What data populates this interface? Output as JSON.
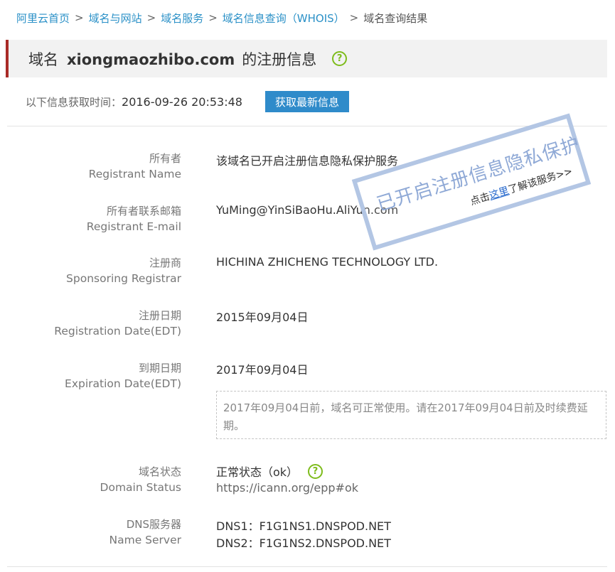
{
  "breadcrumb": {
    "items": [
      {
        "label": "阿里云首页"
      },
      {
        "label": "域名与网站"
      },
      {
        "label": "域名服务"
      },
      {
        "label": "域名信息查询（WHOIS）"
      }
    ],
    "separator": ">",
    "current": "域名查询结果"
  },
  "title": {
    "prefix": "域名",
    "domain": "xiongmaozhibo.com",
    "suffix": "的注册信息",
    "help_icon": "question-circle-icon",
    "help_glyph": "?"
  },
  "fetch": {
    "label": "以下信息获取时间：",
    "time": "2016-09-26 20:53:48",
    "button_label": "获取最新信息"
  },
  "fields": {
    "owner": {
      "label_cn": "所有者",
      "label_en": "Registrant Name",
      "value": "该域名已开启注册信息隐私保护服务"
    },
    "email": {
      "label_cn": "所有者联系邮箱",
      "label_en": "Registrant E-mail",
      "value": "YuMing@YinSiBaoHu.AliYun.com"
    },
    "registrar": {
      "label_cn": "注册商",
      "label_en": "Sponsoring Registrar",
      "value": "HICHINA ZHICHENG TECHNOLOGY LTD."
    },
    "reg_date": {
      "label_cn": "注册日期",
      "label_en": "Registration Date(EDT)",
      "value": "2015年09月04日"
    },
    "exp_date": {
      "label_cn": "到期日期",
      "label_en": "Expiration Date(EDT)",
      "value": "2017年09月04日",
      "note": "2017年09月04日前，域名可正常使用。请在2017年09月04日前及时续费延期。"
    },
    "status": {
      "label_cn": "域名状态",
      "label_en": "Domain Status",
      "value": "正常状态（ok）",
      "link": "https://icann.org/epp#ok",
      "help_glyph": "?"
    },
    "dns": {
      "label_cn": "DNS服务器",
      "label_en": "Name Server",
      "servers": [
        "DNS1：F1G1NS1.DNSPOD.NET",
        "DNS2：F1G1NS2.DNSPOD.NET"
      ]
    }
  },
  "privacy_stamp": {
    "title": "已开启注册信息隐私保护",
    "prefix": "点击",
    "link_text": "这里",
    "suffix": "了解该服务>>"
  },
  "colors": {
    "link_blue": "#2a90c7",
    "title_accent": "#a92b27",
    "button_blue": "#2f8bca",
    "help_green": "#7ebc1c",
    "stamp_blue": "#b3c6e4"
  }
}
